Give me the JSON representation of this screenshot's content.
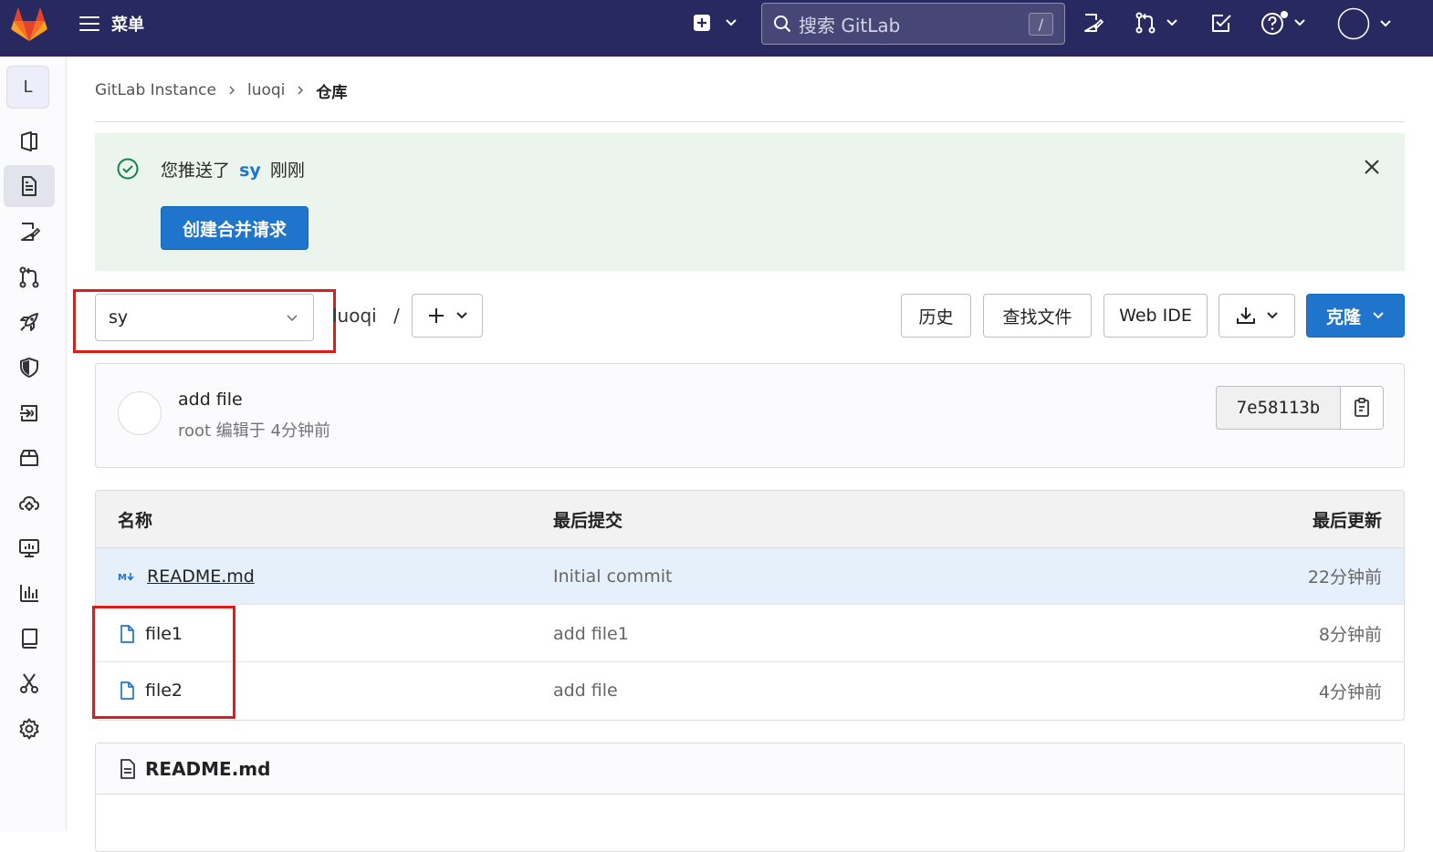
{
  "topbar": {
    "menu_label": "菜单",
    "search_placeholder": "搜索 GitLab",
    "search_shortcut": "/"
  },
  "sidebar": {
    "project_initial": "L",
    "items": [
      "project-overview",
      "repository",
      "issues",
      "merge-requests",
      "ci-cd",
      "security",
      "deployments",
      "packages",
      "infrastructure",
      "monitor",
      "analytics",
      "wiki",
      "snippets",
      "settings"
    ]
  },
  "breadcrumb": {
    "items": [
      "GitLab Instance",
      "luoqi",
      "仓库"
    ]
  },
  "alert": {
    "prefix": "您推送了",
    "branch": "sy",
    "suffix": "刚刚",
    "button": "创建合并请求"
  },
  "toolbar": {
    "branch": "sy",
    "path": "luoqi",
    "path_sep": "/",
    "history": "历史",
    "find_file": "查找文件",
    "web_ide": "Web IDE",
    "clone": "克隆"
  },
  "commit": {
    "title": "add file",
    "meta": "root 编辑于 4分钟前",
    "sha": "7e58113b"
  },
  "files": {
    "headers": {
      "name": "名称",
      "last_commit": "最后提交",
      "last_update": "最后更新"
    },
    "rows": [
      {
        "name": "README.md",
        "type": "markdown",
        "commit": "Initial commit",
        "date": "22分钟前"
      },
      {
        "name": "file1",
        "type": "file",
        "commit": "add file1",
        "date": "8分钟前"
      },
      {
        "name": "file2",
        "type": "file",
        "commit": "add file",
        "date": "4分钟前"
      }
    ]
  },
  "readme": {
    "title": "README.md"
  },
  "colors": {
    "topbar": "#292961",
    "primary": "#1f75cb",
    "alert_bg": "#ecf4ee",
    "success": "#108548",
    "highlight_box": "#dd1c1c"
  }
}
